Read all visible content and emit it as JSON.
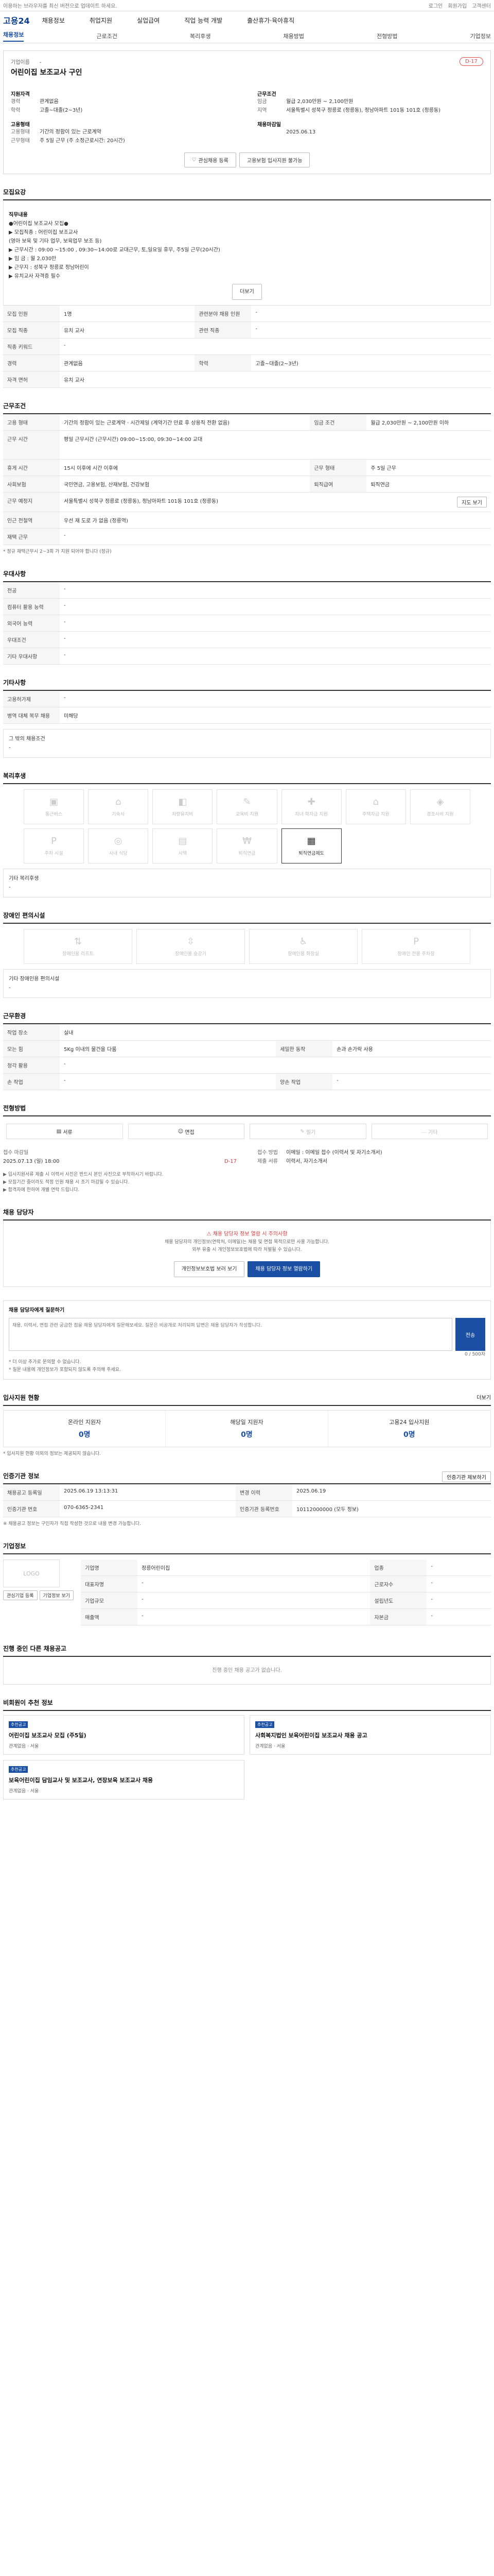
{
  "topbar": {
    "notice": "이용하는 브라우저를 최신 버전으로 업데이트 하세요.",
    "links": [
      "로그인",
      "회원가입",
      "고객센터"
    ]
  },
  "header": {
    "logo": "고용24",
    "menu": [
      "채용정보",
      "취업지원",
      "실업급여",
      "직업 능력 개발",
      "출산휴가·육아휴직"
    ]
  },
  "tabs": [
    "채용정보",
    "근로조건",
    "복리후생",
    "채용방법",
    "전형방법",
    "기업정보"
  ],
  "job": {
    "company_label": "기업이름",
    "company_value": "-",
    "title": "어린이집 보조교사 구인",
    "dday": "D-17",
    "left": [
      {
        "k": "경력",
        "v": "관계없음"
      },
      {
        "k": "학력",
        "v": "고졸~대졸(2~3년)"
      }
    ],
    "right_label": "근무조건",
    "right": [
      {
        "k": "임금",
        "v": "월급 2,030만원 ~ 2,100만원"
      },
      {
        "k": "지역",
        "v": "서울특별시 성북구 정릉로 (정릉동), 정남아파트 101동 101호 (정릉동)"
      }
    ],
    "type_label": "고용형태",
    "type": [
      {
        "k": "고용형태",
        "v": "기간의 정함이 있는 근로계약"
      },
      {
        "k": "근무형태",
        "v": "주 5일 근무 (주 소정근로시간: 20시간)"
      }
    ],
    "sched_label": "채용마감일",
    "sched": [
      {
        "k": "",
        "v": "2025.06.13"
      }
    ],
    "btn_scrap": "관심채용 등록",
    "btn_share": "고용보험 입사지원 불가능"
  },
  "s_duty": {
    "title": "모집요강",
    "sub": "직무내용",
    "lines": [
      "●어린이집 보조교사 모집●",
      "▶ 모집직종 : 어린이집 보조교사",
      "   (영아 보육 및 기타 업무, 보육업무 보조 등)",
      "▶ 근무시간 : 09:00 ~15:00 , 09:30~14:00로 교대근무, 토,일요일 휴무, 주5일 근무(20시간)",
      "▶ 임       금 : 월 2,030만",
      "▶ 근무지 : 성북구 정릉로 정남어린이",
      "▶ 유치교사 자격증 필수"
    ],
    "more": "더보기"
  },
  "s_req": {
    "rows": [
      [
        "모집 인원",
        "1명",
        "관련분야 채용 인원",
        "-"
      ],
      [
        "모집 직종",
        "유치 교사",
        "관련 직종",
        "-"
      ],
      [
        "직종 키워드",
        "-",
        "",
        ""
      ],
      [
        "경력",
        "관계없음",
        "학력",
        "고졸~대졸(2~3년)"
      ],
      [
        "자격 면허",
        "유치 교사",
        "",
        ""
      ]
    ],
    "license": "유치교사"
  },
  "s_work": {
    "title": "근무조건",
    "rows": [
      [
        "고용 형태",
        "기간의 정함이 있는 근로계약 · 시간제일\n(계약기간 만료 후 상용직 전환 없음)",
        "임금 조건",
        "월급 2,030만원 ~ 2,100만원 이하"
      ],
      [
        "근무 시간",
        "평일 근무시간\n(근무시간) 09:00~15:00, 09:30~14:00 교대"
      ],
      [
        "휴게 시간",
        "15시 이후에 시간 이후에",
        "근무 형태",
        "주 5일 근무"
      ],
      [
        "사회보험",
        "국민연금, 고용보험, 산재보험, 건강보험",
        "퇴직급여",
        "퇴직연금"
      ],
      [
        "근무 예정지",
        "서울특별시 성북구 정릉로 (정릉동), 정남아파트 101동 101호 (정릉동)",
        "",
        ""
      ],
      [
        "인근 전철역",
        "우선 재 도로 가 없음 (정릉역)",
        "",
        ""
      ],
      [
        "재택 근무",
        "-",
        "",
        ""
      ]
    ],
    "btn_map": "지도 보기",
    "note": "* 정규 재택근무시 2~3회 가 지원 되어야 합니다 (정규)"
  },
  "s_pref": {
    "title": "우대사항",
    "rows": [
      [
        "전공",
        "-"
      ],
      [
        "컴퓨터 활용 능력",
        "-"
      ],
      [
        "외국어 능력",
        "-"
      ],
      [
        "우대조건",
        "-"
      ],
      [
        "기타 우대사항",
        "-"
      ]
    ]
  },
  "s_etc": {
    "title": "기타사항",
    "rows": [
      [
        "고용허가제",
        "-"
      ],
      [
        "병역 대체 복무 채용",
        "미해당"
      ]
    ],
    "extra_label": "그 밖의 채용조건",
    "extra": "-"
  },
  "s_welfare": {
    "title": "복리후생",
    "items": [
      "통근버스",
      "기숙사",
      "차량유지비",
      "교육비 지원",
      "자녀 학자금 지원",
      "주택자금 지원",
      "경조사비 지원",
      "주차 시설",
      "사내 식당",
      "사택",
      "퇴직연금",
      "퇴직연금제도"
    ],
    "other_label": "기타 복리후생",
    "other": "-"
  },
  "s_disabled": {
    "title": "장애인 편의시설",
    "items": [
      "장애인용 리프트",
      "장애인용 승강기",
      "장애인용 화장실",
      "장애인 전용 주차장"
    ],
    "other_label": "기타 장애인용 편의시설",
    "other": "-"
  },
  "s_place": {
    "title": "근무환경",
    "rows": [
      [
        "작업 장소",
        "실내",
        "",
        ""
      ],
      [
        "모는 힘",
        "5Kg 이내의 물건을 다룸",
        "세밀한 동작",
        "손과 손가락 사용"
      ],
      [
        "청각 활용",
        "-",
        "",
        ""
      ],
      [
        "손 작업",
        "-",
        "양손 작업",
        "-"
      ]
    ]
  },
  "s_method": {
    "title": "전형방법",
    "items": [
      "서류",
      "면접",
      "필기",
      "기타"
    ],
    "date_label": "접수 마감일",
    "date": "2025.07.13 (일) 18:00",
    "days": "D-17",
    "apply_label": "접수 방법",
    "apply": "이메일 : 이메일 접수 (이력서 및 자기소개서)",
    "docs_label": "제출 서류",
    "docs": "이력서, 자기소개서",
    "notes": [
      "▶ 입사지원서류 제출 시 이력서 사진은 반드시 본인 사진으로 부착하시기 바랍니다.",
      "▶ 모집기간 중이라도 적정 인원 채용 시 조기 마감될 수 있습니다.",
      "▶ 합격자에 한하여 개별 연락 드립니다."
    ]
  },
  "s_manager": {
    "title": "채용 담당자",
    "warn": "채용 담당자 정보 열람 시 주의사항",
    "desc": [
      "채용 담당자의 개인정보(연락처, 이메일)는 채용 및 면접 목적으로만 사용 가능합니다.",
      "외부 유출 시 개인정보보호법에 따라 처벌될 수 있습니다."
    ],
    "btn_view": "개인정보보호법 보러 보기",
    "btn_phone": "채용 담당자 정보 열람하기"
  },
  "s_inquiry": {
    "title": "채용 담당자에게 질문하기",
    "placeholder": "채용, 이력서, 면접 관련 궁금한 점을 채용 담당자에게 질문해보세요. 질문은 비공개로 처리되며 답변은 채용 담당자가 작성합니다.",
    "btn": "전송",
    "counter": "0 / 500자",
    "notes": [
      "* 더 이상 추가로 문의할 수 없습니다.",
      "* 질문 내용에 개인정보가 포함되지 않도록 주의해 주세요."
    ]
  },
  "s_stats": {
    "title": "입사지원 현황",
    "more": "더보기",
    "items": [
      {
        "label": "온라인 지원자",
        "value": "0명"
      },
      {
        "label": "해당일 지원자",
        "value": "0명"
      },
      {
        "label": "고용24 입사지원",
        "value": "0명"
      }
    ],
    "note": "* 입사지원 현황 이외의 정보는 제공되지 않습니다."
  },
  "s_agency": {
    "title": "인증기관 정보",
    "btn": "인증기관 제보하기",
    "rows": [
      [
        "채용공고 등록일",
        "2025.06.19 13:13:31",
        "변경 이력",
        "2025.06.19"
      ],
      [
        "인증기관 번호",
        "070-6365-2341",
        "인증기관 등록번호",
        "10112000000 (모두 정보)"
      ]
    ],
    "note": "※ 채용공고 정보는 구인자가 직접 작성한 것으로 내용 변경 가능합니다."
  },
  "s_company": {
    "title": "기업정보",
    "logo": "LOGO",
    "rows": [
      [
        "기업명",
        "정릉어린이집",
        "업종",
        "-"
      ],
      [
        "대표자명",
        "-",
        "근로자수",
        "-"
      ],
      [
        "기업규모",
        "-",
        "설립년도",
        "-"
      ],
      [
        "매출액",
        "-",
        "자본금",
        "-"
      ]
    ],
    "btn_follow": "관심기업 등록",
    "btn_view": "기업정보 보기"
  },
  "s_more": {
    "title": "진행 중인 다른 채용공고",
    "empty": "진행 중인 채용 공고가 없습니다."
  },
  "s_rec": {
    "title": "비회원이 추천 정보",
    "items": [
      {
        "badge": "추천공고",
        "title": "어린이집 보조교사 모집 (주5일)",
        "meta": "관계없음 · 서울"
      },
      {
        "badge": "추천공고",
        "title": "사회복지법인 보육어린이집 보조교사 채용 공고",
        "meta": "관계없음 · 서울"
      },
      {
        "badge": "추천공고",
        "title": "보육어린이집 담임교사 및 보조교사, 연장보육 보조교사 채용",
        "meta": "관계없음 · 서울"
      }
    ]
  }
}
